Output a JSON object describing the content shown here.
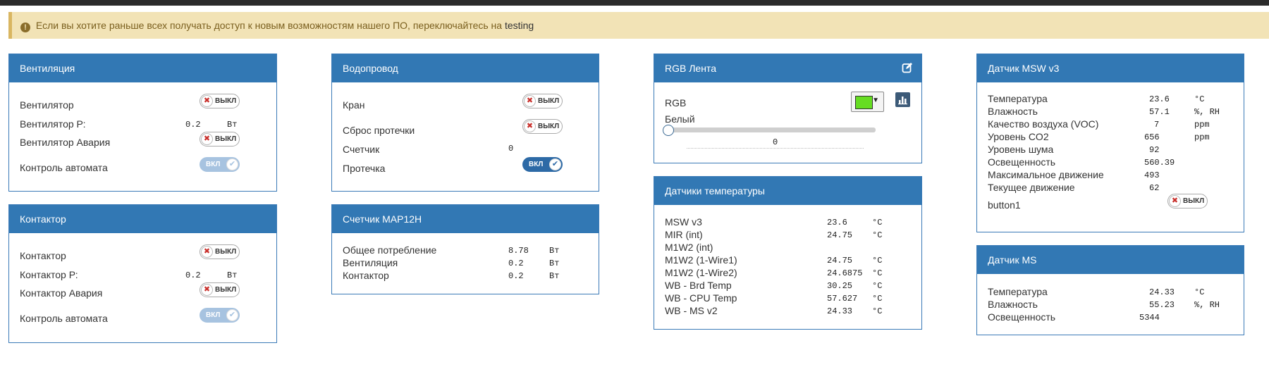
{
  "alert": {
    "text": "Если вы хотите раньше всех получать доступ к новым возможностям нашего ПО, переключайтесь на",
    "link": "testing"
  },
  "switch_labels": {
    "on": "ВКЛ",
    "off": "ВЫКЛ"
  },
  "ventilation": {
    "title": "Вентиляция",
    "rows": [
      {
        "label": "Вентилятор",
        "state": "off"
      },
      {
        "label": "Вентилятор Р:",
        "value": "0.2",
        "unit": "Вт"
      },
      {
        "label": "Вентилятор Авария",
        "state": "off"
      },
      {
        "label": "Контроль автомата",
        "state": "on-readonly"
      }
    ]
  },
  "contactor": {
    "title": "Контактор",
    "rows": [
      {
        "label": "Контактор",
        "state": "off"
      },
      {
        "label": "Контактор Р:",
        "value": "0.2",
        "unit": "Вт"
      },
      {
        "label": "Контактор Авария",
        "state": "off"
      },
      {
        "label": "Контроль автомата",
        "state": "on-readonly"
      }
    ]
  },
  "water": {
    "title": "Водопровод",
    "rows": [
      {
        "label": "Кран",
        "state": "off"
      },
      {
        "label": "Сброс протечки",
        "state": "off"
      },
      {
        "label": "Счетчик",
        "value": "0"
      },
      {
        "label": "Протечка",
        "state": "on"
      }
    ]
  },
  "meter": {
    "title": "Счетчик MAP12H",
    "rows": [
      {
        "label": "Общее потребление",
        "value": "8.78",
        "unit": "Вт"
      },
      {
        "label": "Вентиляция",
        "value": "0.2",
        "unit": "Вт"
      },
      {
        "label": "Контактор",
        "value": "0.2",
        "unit": "Вт"
      }
    ]
  },
  "rgb": {
    "title": "RGB Лента",
    "rgb_label": "RGB",
    "color": "#66dd22",
    "white_label": "Белый",
    "white_value": "0",
    "white_level": 0
  },
  "temps": {
    "title": "Датчики температуры",
    "rows": [
      {
        "label": "MSW v3",
        "value": "23.6",
        "unit": "°C"
      },
      {
        "label": "MIR (int)",
        "value": "24.75",
        "unit": "°C"
      },
      {
        "label": "M1W2 (int)",
        "value": "",
        "unit": ""
      },
      {
        "label": "M1W2 (1-Wire1)",
        "value": "24.75",
        "unit": "°C"
      },
      {
        "label": "M1W2 (1-Wire2)",
        "value": "24.6875",
        "unit": "°C"
      },
      {
        "label": "WB - Brd Temp",
        "value": "30.25",
        "unit": "°C"
      },
      {
        "label": "WB - CPU Temp",
        "value": "57.627",
        "unit": "°C"
      },
      {
        "label": "WB - MS v2",
        "value": "24.33",
        "unit": "°C"
      }
    ]
  },
  "msw": {
    "title": "Датчик MSW v3",
    "rows": [
      {
        "label": "Температура",
        "value": "23.6",
        "unit": "°C"
      },
      {
        "label": "Влажность",
        "value": "57.1",
        "unit": "%, RH"
      },
      {
        "label": "Качество воздуха (VOC)",
        "value": "7",
        "unit": "ppm"
      },
      {
        "label": "Уровень CO2",
        "value": "656",
        "unit": "ppm"
      },
      {
        "label": "Уровень шума",
        "value": "92",
        "unit": ""
      },
      {
        "label": "Освещенность",
        "value": "560.39",
        "unit": ""
      },
      {
        "label": "Максимальное движение",
        "value": "493",
        "unit": ""
      },
      {
        "label": "Текущее движение",
        "value": "62",
        "unit": ""
      }
    ],
    "button_label": "button1",
    "button_state": "off"
  },
  "ms": {
    "title": "Датчик MS",
    "rows": [
      {
        "label": "Температура",
        "value": "24.33",
        "unit": "°C"
      },
      {
        "label": "Влажность",
        "value": "55.23",
        "unit": "%, RH"
      },
      {
        "label": "Освещенность",
        "value": "5344",
        "unit": ""
      }
    ]
  }
}
